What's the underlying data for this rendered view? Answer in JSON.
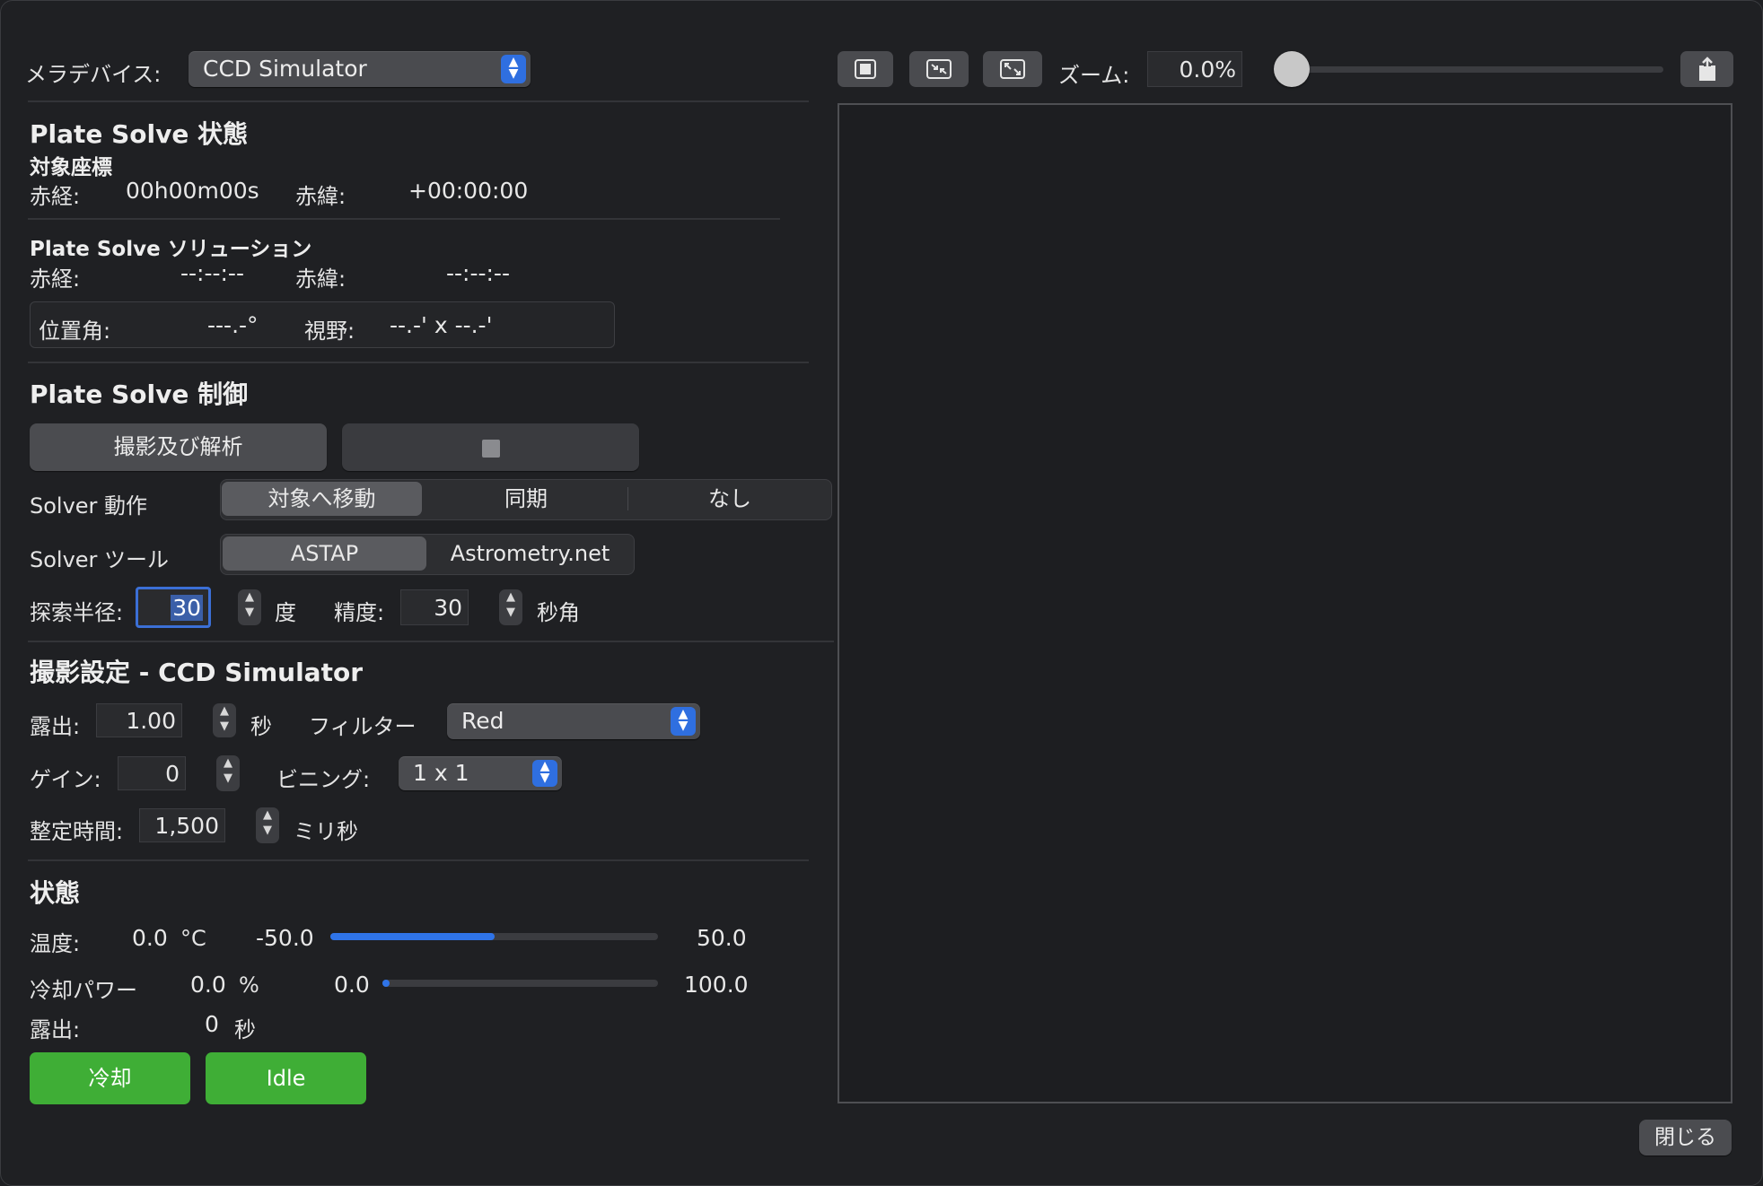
{
  "device": {
    "label": "メラデバイス:",
    "selected": "CCD Simulator"
  },
  "status_section": {
    "title": "Plate Solve 状態",
    "target_heading": "対象座標",
    "ra_label": "赤経:",
    "ra_value": "00h00m00s",
    "dec_label": "赤緯:",
    "dec_value": "+00:00:00"
  },
  "solution_section": {
    "title": "Plate Solve ソリューション",
    "ra_label": "赤経:",
    "ra_value": "--:--:--",
    "dec_label": "赤緯:",
    "dec_value": "--:--:--",
    "pa_label": "位置角:",
    "pa_value": "---.-°",
    "fov_label": "視野:",
    "fov_value": "--.-' x --.-'"
  },
  "control_section": {
    "title": "Plate Solve 制御",
    "capture_button": "撮影及び解析",
    "solver_action_label": "Solver 動作",
    "solver_actions": [
      "対象へ移動",
      "同期",
      "なし"
    ],
    "solver_action_selected": "対象へ移動",
    "solver_tool_label": "Solver ツール",
    "solver_tools": [
      "ASTAP",
      "Astrometry.net"
    ],
    "solver_tool_selected": "ASTAP",
    "radius_label": "探索半径:",
    "radius_value": "30",
    "radius_unit": "度",
    "accuracy_label": "精度:",
    "accuracy_value": "30",
    "accuracy_unit": "秒角"
  },
  "capture_section": {
    "title": "撮影設定 - CCD Simulator",
    "exposure_label": "露出:",
    "exposure_value": "1.00",
    "exposure_unit": "秒",
    "filter_label": "フィルター",
    "filter_value": "Red",
    "gain_label": "ゲイン:",
    "gain_value": "0",
    "binning_label": "ビニング:",
    "binning_value": "1 x 1",
    "settle_label": "整定時間:",
    "settle_value": "1,500",
    "settle_unit": "ミリ秒"
  },
  "state_section": {
    "title": "状態",
    "temp_label": "温度:",
    "temp_value": "0.0",
    "temp_unit": "°C",
    "temp_min": "-50.0",
    "temp_max": "50.0",
    "temp_fraction": 0.5,
    "cooler_label": "冷却パワー",
    "cooler_value": "0.0",
    "cooler_unit": "%",
    "cooler_min": "0.0",
    "cooler_max": "100.0",
    "cooler_fraction": 0.0,
    "exposure_label": "露出:",
    "exposure_value": "0",
    "exposure_unit": "秒",
    "cool_button": "冷却",
    "idle_button": "Idle"
  },
  "viewer": {
    "zoom_label": "ズーム:",
    "zoom_value": "0.0%",
    "zoom_fraction": 0.0
  },
  "close_button": "閉じる",
  "colors": {
    "accent": "#2f74e8",
    "green": "#3fae36",
    "background": "#1f2023"
  },
  "icons": [
    "chevron-updown-icon",
    "stop-icon",
    "fit-icon",
    "shrink-icon",
    "expand-icon",
    "share-icon"
  ]
}
